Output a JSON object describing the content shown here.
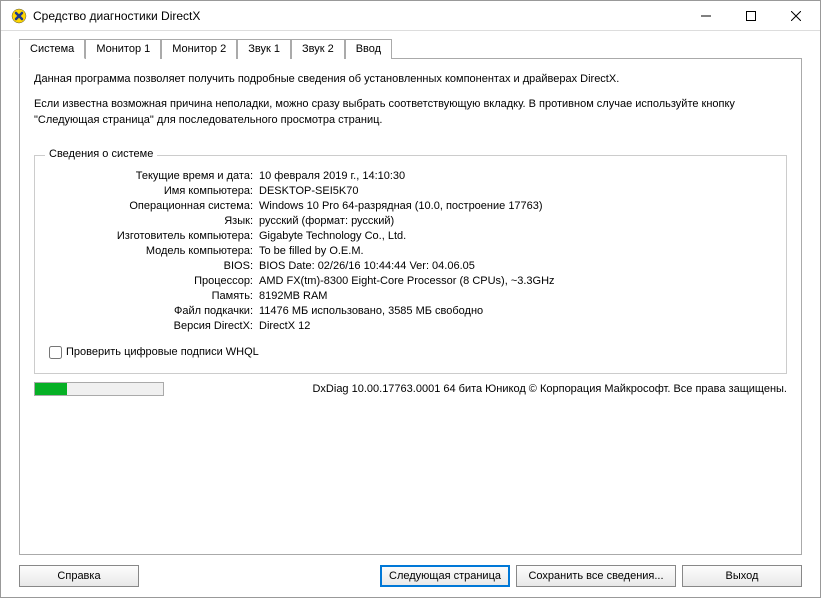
{
  "window": {
    "title": "Средство диагностики DirectX"
  },
  "tabs": [
    {
      "label": "Система",
      "active": true
    },
    {
      "label": "Монитор 1",
      "active": false
    },
    {
      "label": "Монитор 2",
      "active": false
    },
    {
      "label": "Звук 1",
      "active": false
    },
    {
      "label": "Звук 2",
      "active": false
    },
    {
      "label": "Ввод",
      "active": false
    }
  ],
  "intro": {
    "p1": "Данная программа позволяет получить подробные сведения об установленных компонентах и драйверах DirectX.",
    "p2": "Если известна возможная причина неполадки, можно сразу выбрать соответствующую вкладку. В противном случае используйте кнопку \"Следующая страница\" для последовательного просмотра страниц."
  },
  "groupbox_title": "Сведения о системе",
  "info": [
    {
      "label": "Текущие время и дата:",
      "value": "10 февраля 2019 г., 14:10:30"
    },
    {
      "label": "Имя компьютера:",
      "value": "DESKTOP-SEI5K70"
    },
    {
      "label": "Операционная система:",
      "value": "Windows 10 Pro 64-разрядная (10.0, построение 17763)"
    },
    {
      "label": "Язык:",
      "value": "русский (формат: русский)"
    },
    {
      "label": "Изготовитель компьютера:",
      "value": "Gigabyte Technology Co., Ltd."
    },
    {
      "label": "Модель компьютера:",
      "value": "To be filled by O.E.M."
    },
    {
      "label": "BIOS:",
      "value": "BIOS Date: 02/26/16 10:44:44 Ver: 04.06.05"
    },
    {
      "label": "Процессор:",
      "value": "AMD FX(tm)-8300 Eight-Core Processor            (8 CPUs), ~3.3GHz"
    },
    {
      "label": "Память:",
      "value": "8192MB RAM"
    },
    {
      "label": "Файл подкачки:",
      "value": "11476 МБ использовано, 3585 МБ свободно"
    },
    {
      "label": "Версия DirectX:",
      "value": "DirectX 12"
    }
  ],
  "checkbox_label": "Проверить цифровые подписи WHQL",
  "footer": "DxDiag 10.00.17763.0001 64 бита Юникод © Корпорация Майкрософт. Все права защищены.",
  "buttons": {
    "help": "Справка",
    "next": "Следующая страница",
    "save": "Сохранить все сведения...",
    "exit": "Выход"
  },
  "progress_percent": 25
}
